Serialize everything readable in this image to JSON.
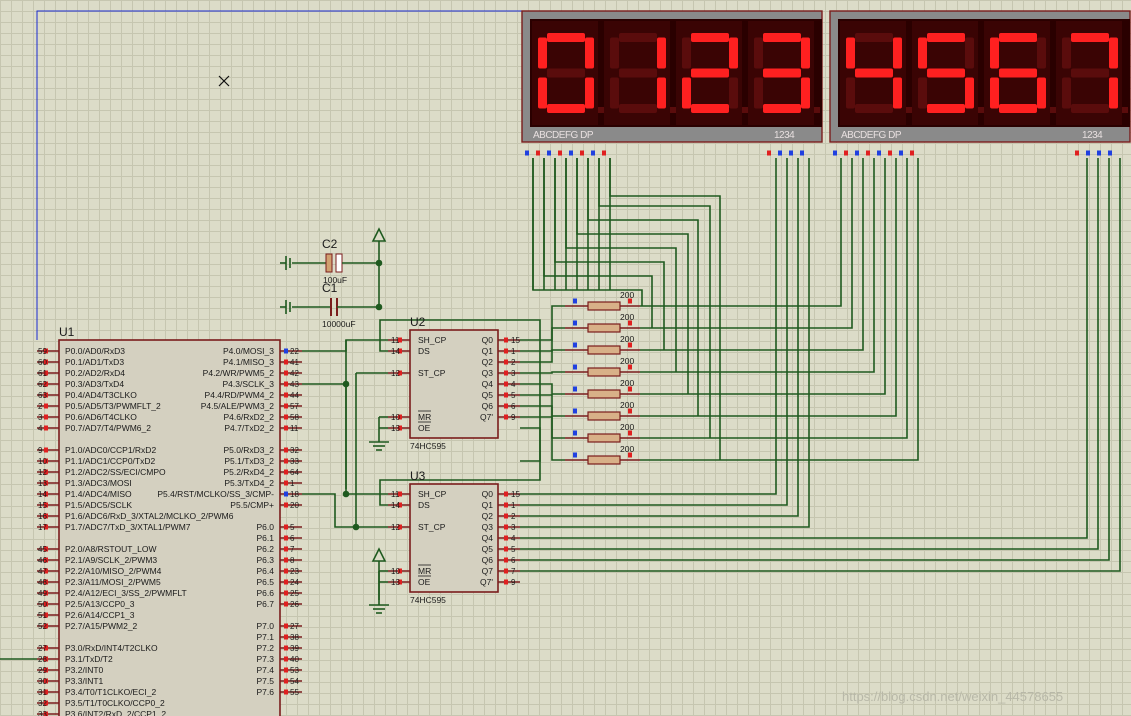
{
  "u1": {
    "ref": "U1",
    "left_pins": [
      {
        "num": "59",
        "name": "P0.0/AD0/RxD3"
      },
      {
        "num": "60",
        "name": "P0.1/AD1/TxD3"
      },
      {
        "num": "61",
        "name": "P0.2/AD2/RxD4"
      },
      {
        "num": "62",
        "name": "P0.3/AD3/TxD4"
      },
      {
        "num": "63",
        "name": "P0.4/AD4/T3CLKO"
      },
      {
        "num": "2",
        "name": "P0.5/AD5/T3/PWMFLT_2"
      },
      {
        "num": "3",
        "name": "P0.6/AD6/T4CLKO"
      },
      {
        "num": "4",
        "name": "P0.7/AD7/T4/PWM6_2"
      },
      {
        "num": "9",
        "name": "P1.0/ADC0/CCP1/RxD2"
      },
      {
        "num": "10",
        "name": "P1.1/ADC1/CCP0/TxD2"
      },
      {
        "num": "12",
        "name": "P1.2/ADC2/SS/ECI/CMPO"
      },
      {
        "num": "13",
        "name": "P1.3/ADC3/MOSI"
      },
      {
        "num": "14",
        "name": "P1.4/ADC4/MISO"
      },
      {
        "num": "15",
        "name": "P1.5/ADC5/SCLK"
      },
      {
        "num": "16",
        "name": "P1.6/ADC6/RxD_3/XTAL2/MCLKO_2/PWM6"
      },
      {
        "num": "17",
        "name": "P1.7/ADC7/TxD_3/XTAL1/PWM7"
      },
      {
        "num": "45",
        "name": "P2.0/A8/RSTOUT_LOW"
      },
      {
        "num": "46",
        "name": "P2.1/A9/SCLK_2/PWM3"
      },
      {
        "num": "47",
        "name": "P2.2/A10/MISO_2/PWM4"
      },
      {
        "num": "48",
        "name": "P2.3/A11/MOSI_2/PWM5"
      },
      {
        "num": "49",
        "name": "P2.4/A12/ECI_3/SS_2/PWMFLT"
      },
      {
        "num": "50",
        "name": "P2.5/A13/CCP0_3"
      },
      {
        "num": "51",
        "name": "P2.6/A14/CCP1_3"
      },
      {
        "num": "52",
        "name": "P2.7/A15/PWM2_2"
      },
      {
        "num": "27",
        "name": "P3.0/RxD/INT4/T2CLKO"
      },
      {
        "num": "28",
        "name": "P3.1/TxD/T2"
      },
      {
        "num": "29",
        "name": "P3.2/INT0"
      },
      {
        "num": "30",
        "name": "P3.3/INT1"
      },
      {
        "num": "31",
        "name": "P3.4/T0/T1CLKO/ECI_2"
      },
      {
        "num": "32",
        "name": "P3.5/T1/T0CLKO/CCP0_2"
      },
      {
        "num": "33",
        "name": "P3.6/INT2/RxD_2/CCP1_2"
      }
    ],
    "right_pins": [
      {
        "num": "22",
        "name": "P4.0/MOSI_3"
      },
      {
        "num": "41",
        "name": "P4.1/MISO_3"
      },
      {
        "num": "42",
        "name": "P4.2/WR/PWM5_2"
      },
      {
        "num": "43",
        "name": "P4.3/SCLK_3"
      },
      {
        "num": "44",
        "name": "P4.4/RD/PWM4_2"
      },
      {
        "num": "57",
        "name": "P4.5/ALE/PWM3_2"
      },
      {
        "num": "58",
        "name": "P4.6/RxD2_2"
      },
      {
        "num": "11",
        "name": "P4.7/TxD2_2"
      },
      {
        "num": "32",
        "name": "P5.0/RxD3_2"
      },
      {
        "num": "33",
        "name": "P5.1/TxD3_2"
      },
      {
        "num": "64",
        "name": "P5.2/RxD4_2"
      },
      {
        "num": "1",
        "name": "P5.3/TxD4_2"
      },
      {
        "num": "18",
        "name": "P5.4/RST/MCLKO/SS_3/CMP-"
      },
      {
        "num": "20",
        "name": "P5.5/CMP+"
      },
      {
        "num": "5",
        "name": "P6.0"
      },
      {
        "num": "6",
        "name": "P6.1"
      },
      {
        "num": "7",
        "name": "P6.2"
      },
      {
        "num": "8",
        "name": "P6.3"
      },
      {
        "num": "23",
        "name": "P6.4"
      },
      {
        "num": "24",
        "name": "P6.5"
      },
      {
        "num": "25",
        "name": "P6.6"
      },
      {
        "num": "26",
        "name": "P6.7"
      },
      {
        "num": "27",
        "name": "P7.0"
      },
      {
        "num": "38",
        "name": "P7.1"
      },
      {
        "num": "39",
        "name": "P7.2"
      },
      {
        "num": "40",
        "name": "P7.3"
      },
      {
        "num": "53",
        "name": "P7.4"
      },
      {
        "num": "54",
        "name": "P7.5"
      },
      {
        "num": "55",
        "name": "P7.6"
      }
    ]
  },
  "u2": {
    "ref": "U2",
    "device": "74HC595",
    "left_pins": [
      {
        "num": "11",
        "name": "SH_CP"
      },
      {
        "num": "14",
        "name": "DS"
      },
      {
        "num": "12",
        "name": "ST_CP"
      },
      {
        "num": "10",
        "name": "MR"
      },
      {
        "num": "13",
        "name": "OE"
      }
    ],
    "right_pins": [
      {
        "num": "15",
        "name": "Q0"
      },
      {
        "num": "1",
        "name": "Q1"
      },
      {
        "num": "2",
        "name": "Q2"
      },
      {
        "num": "3",
        "name": "Q3"
      },
      {
        "num": "4",
        "name": "Q4"
      },
      {
        "num": "5",
        "name": "Q5"
      },
      {
        "num": "6",
        "name": "Q6"
      },
      {
        "num": "9",
        "name": "Q7'"
      }
    ]
  },
  "u3": {
    "ref": "U3",
    "device": "74HC595",
    "left_pins": [
      {
        "num": "11",
        "name": "SH_CP"
      },
      {
        "num": "14",
        "name": "DS"
      },
      {
        "num": "12",
        "name": "ST_CP"
      },
      {
        "num": "10",
        "name": "MR"
      },
      {
        "num": "13",
        "name": "OE"
      }
    ],
    "right_pins": [
      {
        "num": "15",
        "name": "Q0"
      },
      {
        "num": "1",
        "name": "Q1"
      },
      {
        "num": "2",
        "name": "Q2"
      },
      {
        "num": "3",
        "name": "Q3"
      },
      {
        "num": "4",
        "name": "Q4"
      },
      {
        "num": "5",
        "name": "Q5"
      },
      {
        "num": "6",
        "name": "Q6"
      },
      {
        "num": "7",
        "name": "Q7"
      },
      {
        "num": "9",
        "name": "Q7'"
      }
    ]
  },
  "capacitors": [
    {
      "ref": "C2",
      "value": "100uF"
    },
    {
      "ref": "C1",
      "value": "10000uF"
    }
  ],
  "resistors": {
    "value": "200",
    "count": 8
  },
  "displays": [
    {
      "digits": [
        "0",
        "1",
        "2",
        "3"
      ],
      "seg_label": "ABCDEFG DP",
      "com_label": "1234"
    },
    {
      "digits": [
        "4",
        "5",
        "6",
        "7"
      ],
      "seg_label": "ABCDEFG DP",
      "com_label": "1234"
    }
  ],
  "watermark": "https://blog.csdn.net/weixin_44578655",
  "colors": {
    "wire": "#1f5a1f",
    "component": "#7a1c1c",
    "chip_fill": "#d4d0c0",
    "segment_on": "#ff2020",
    "segment_off": "#5a0c0c",
    "display_bg": "#2a0000",
    "pin_red": "#e02020",
    "pin_blue": "#2040e0"
  }
}
